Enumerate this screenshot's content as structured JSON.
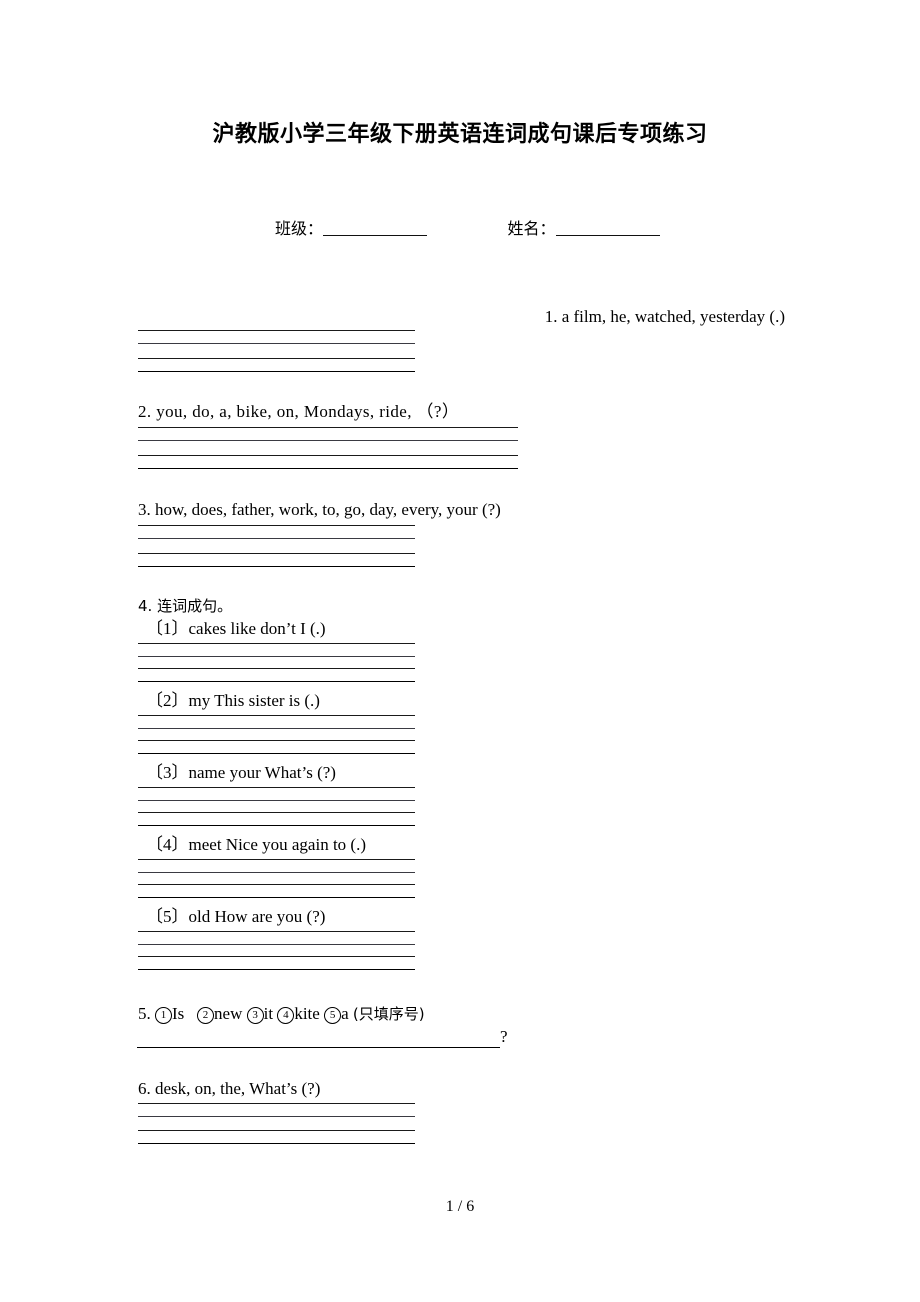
{
  "document": {
    "title": "沪教版小学三年级下册英语连词成句课后专项练习",
    "footer_page": "1 / 6"
  },
  "info_row": {
    "class_label": "班级：",
    "name_label": "姓名："
  },
  "questions": [
    {
      "id": "q1",
      "text": "1. a film, he, watched, yesterday (.)",
      "align": "right",
      "answer_lines": 4
    },
    {
      "id": "q2",
      "text": "2. you,  do,  a,  bike,  on,  Mondays,  ride,  （?）",
      "align": "left",
      "answer_lines": 4
    },
    {
      "id": "q3",
      "text": "3. how, does, father, work, to, go, day, every, your (?)",
      "align": "left",
      "answer_lines": 4
    },
    {
      "id": "q4",
      "text": "4. 连词成句。",
      "align": "left",
      "answer_lines": 0,
      "sub_items": [
        {
          "marker": "〔1〕",
          "text": "cakes  like  don’t  I (.)",
          "answer_lines": 4
        },
        {
          "marker": "〔2〕",
          "text": "my  This  sister  is (.)",
          "answer_lines": 4
        },
        {
          "marker": "〔3〕",
          "text": "name  your  What’s (?)",
          "answer_lines": 4
        },
        {
          "marker": "〔4〕",
          "text": "meet  Nice  you  again  to (.)",
          "answer_lines": 4
        },
        {
          "marker": "〔5〕",
          "text": "old  How  are  you (?)",
          "answer_lines": 4
        }
      ]
    },
    {
      "id": "q5",
      "prefix": "5.",
      "choices": [
        {
          "num": "1",
          "word": "Is"
        },
        {
          "num": "2",
          "word": "new"
        },
        {
          "num": "3",
          "word": "it"
        },
        {
          "num": "4",
          "word": "kite"
        },
        {
          "num": "5",
          "word": "a"
        }
      ],
      "note": "(只填序号)",
      "trailing_mark": "?",
      "answer_lines": 1
    },
    {
      "id": "q6",
      "text": "6. desk, on, the, What’s (?)",
      "align": "left",
      "answer_lines": 4
    }
  ]
}
